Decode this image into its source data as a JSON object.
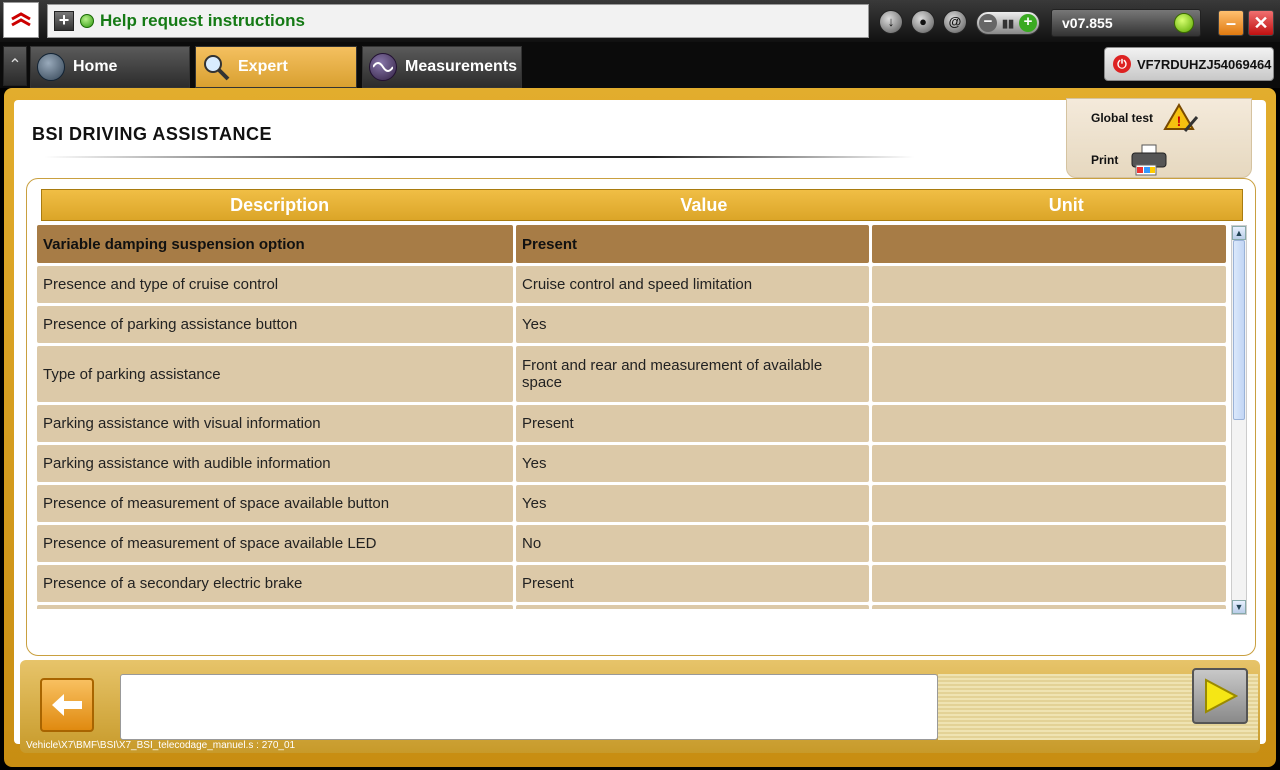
{
  "topbar": {
    "help_text": "Help request instructions",
    "version": "v07.855",
    "minimize_symbol": "–",
    "close_symbol": "✕"
  },
  "tabs": [
    {
      "label": "Home"
    },
    {
      "label": "Expert"
    },
    {
      "label": "Measurements"
    }
  ],
  "vin": "VF7RDUHZJ54069464",
  "page": {
    "title": "BSI  DRIVING ASSISTANCE",
    "global_test_label": "Global test",
    "print_label": "Print"
  },
  "table": {
    "columns": [
      "Description",
      "Value",
      "Unit"
    ],
    "rows": [
      {
        "desc": "Variable damping suspension option",
        "value": "Present",
        "unit": ""
      },
      {
        "desc": "Presence and type of cruise control",
        "value": "Cruise control and speed limitation",
        "unit": ""
      },
      {
        "desc": "Presence of parking assistance button",
        "value": "Yes",
        "unit": ""
      },
      {
        "desc": "Type of parking assistance",
        "value": "Front and rear and measurement of available space",
        "unit": ""
      },
      {
        "desc": "Parking assistance with visual information",
        "value": "Present",
        "unit": ""
      },
      {
        "desc": "Parking assistance with audible information",
        "value": "Yes",
        "unit": ""
      },
      {
        "desc": "Presence of measurement of space available button",
        "value": "Yes",
        "unit": ""
      },
      {
        "desc": "Presence of measurement of space available LED",
        "value": "No",
        "unit": ""
      },
      {
        "desc": "Presence of a secondary electric brake",
        "value": "Present",
        "unit": ""
      }
    ]
  },
  "footer": {
    "path": "Vehicle\\X7\\BMF\\BSI\\X7_BSI_telecodage_manuel.s : 270_01"
  },
  "colors": {
    "accent": "#dba528",
    "row_highlight": "#a77c46",
    "row": "#dcc9a8"
  }
}
